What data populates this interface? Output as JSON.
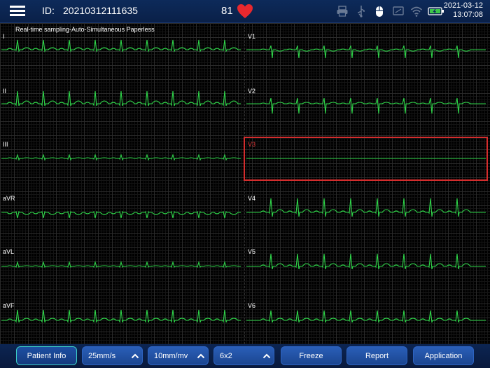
{
  "header": {
    "menu_icon": "hamburger-menu-icon",
    "id_label": "ID:",
    "id_value": "20210312111635",
    "heart_rate": "81",
    "heart_icon": "heart-icon",
    "heart_color": "#e8282e",
    "system_icons": [
      "printer-icon",
      "usb-icon",
      "mouse-icon",
      "screen-icon",
      "wifi-icon",
      "battery-icon"
    ],
    "date": "2021-03-12",
    "time": "13:07:08"
  },
  "display": {
    "subtitle": "Real-time sampling-Auto-Simultaneous Paperless",
    "trace_color": "#2fd84a",
    "selection_color": "#d42d2d",
    "left_leads": [
      "I",
      "II",
      "III",
      "aVR",
      "aVL",
      "aVF"
    ],
    "right_leads": [
      "V1",
      "V2",
      "V3",
      "V4",
      "V5",
      "V6"
    ],
    "selected_lead": "V3"
  },
  "toolbar": {
    "patient_info": "Patient Info",
    "speed": "25mm/s",
    "gain": "10mm/mv",
    "layout": "6x2",
    "freeze": "Freeze",
    "report": "Report",
    "application": "Application"
  }
}
